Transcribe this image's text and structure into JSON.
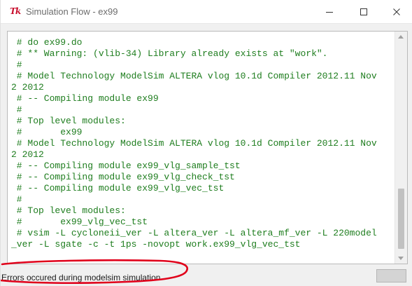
{
  "window": {
    "app_icon_glyph": "Tk",
    "title": "Simulation Flow - ex99"
  },
  "transcript": [
    " # do ex99.do",
    " # ** Warning: (vlib-34) Library already exists at \"work\".",
    " #",
    " # Model Technology ModelSim ALTERA vlog 10.1d Compiler 2012.11 Nov",
    "2 2012",
    " # -- Compiling module ex99",
    " #",
    " # Top level modules:",
    " #       ex99",
    " # Model Technology ModelSim ALTERA vlog 10.1d Compiler 2012.11 Nov",
    "2 2012",
    " # -- Compiling module ex99_vlg_sample_tst",
    " # -- Compiling module ex99_vlg_check_tst",
    " # -- Compiling module ex99_vlg_vec_tst",
    " #",
    " # Top level modules:",
    " #       ex99_vlg_vec_tst",
    " # vsim -L cycloneii_ver -L altera_ver -L altera_mf_ver -L 220model",
    "_ver -L sgate -c -t 1ps -novopt work.ex99_vlg_vec_tst"
  ],
  "status": {
    "message": "Errors occured during modelsim simulation"
  },
  "colors": {
    "transcript_text": "#1e7d1e",
    "annotation_stroke": "#e0001a"
  },
  "icons": {
    "app": "tk-feather-icon",
    "minimize": "minimize-icon",
    "maximize": "maximize-icon",
    "close": "close-icon"
  }
}
